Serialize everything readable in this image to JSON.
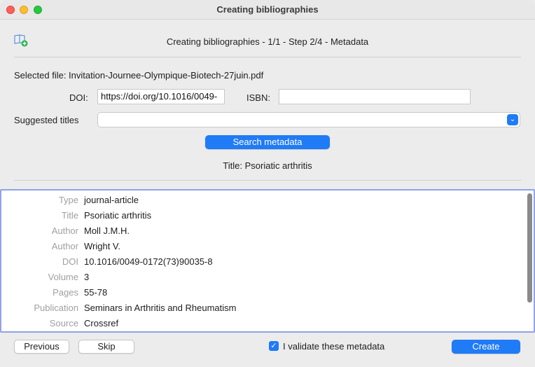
{
  "window": {
    "title": "Creating bibliographies"
  },
  "header": {
    "step_title": "Creating bibliographies - 1/1 - Step 2/4 - Metadata"
  },
  "file": {
    "selected_label": "Selected file: Invitation-Journee-Olympique-Biotech-27juin.pdf"
  },
  "form": {
    "doi_label": "DOI:",
    "doi_value": "https://doi.org/10.1016/0049-",
    "isbn_label": "ISBN:",
    "isbn_value": "",
    "suggested_label": "Suggested titles",
    "suggested_value": ""
  },
  "search_button": "Search metadata",
  "found_title": "Title: Psoriatic arthritis",
  "metadata": [
    {
      "key": "Type",
      "value": "journal-article"
    },
    {
      "key": "Title",
      "value": "Psoriatic arthritis"
    },
    {
      "key": "Author",
      "value": "Moll J.M.H."
    },
    {
      "key": "Author",
      "value": "Wright V."
    },
    {
      "key": "DOI",
      "value": "10.1016/0049-0172(73)90035-8"
    },
    {
      "key": "Volume",
      "value": "3"
    },
    {
      "key": "Pages",
      "value": "55-78"
    },
    {
      "key": "Publication",
      "value": "Seminars in Arthritis and Rheumatism"
    },
    {
      "key": "Source",
      "value": "Crossref"
    }
  ],
  "footer": {
    "previous": "Previous",
    "skip": "Skip",
    "validate_label": "I validate these metadata",
    "validate_checked": true,
    "create": "Create"
  },
  "colors": {
    "accent": "#1f7bf6",
    "panel_border": "#8fa3e6"
  }
}
